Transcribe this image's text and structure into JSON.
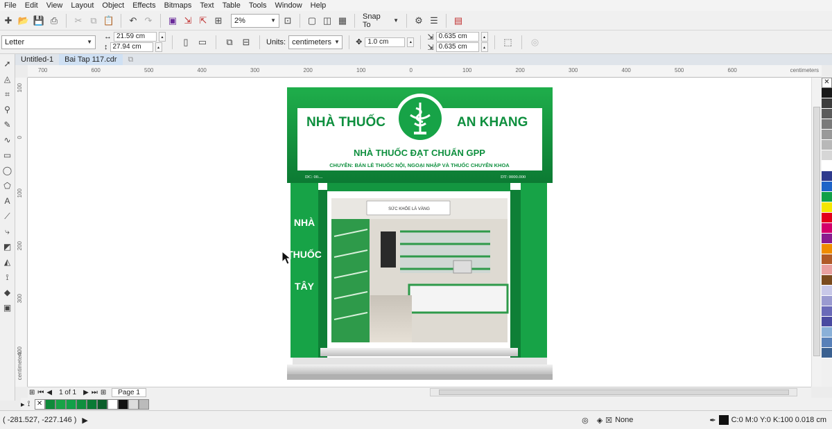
{
  "menu": [
    "File",
    "Edit",
    "View",
    "Layout",
    "Object",
    "Effects",
    "Bitmaps",
    "Text",
    "Table",
    "Tools",
    "Window",
    "Help"
  ],
  "toolbar": {
    "zoom": "2%",
    "snap_label": "Snap To"
  },
  "property_bar": {
    "paper": "Letter",
    "width": "21.59 cm",
    "height": "27.94 cm",
    "units_label": "Units:",
    "units": "centimeters",
    "nudge": "1.0 cm",
    "dup_x": "0.635 cm",
    "dup_y": "0.635 cm"
  },
  "doc_tabs": [
    "Untitled-1",
    "Bai Tap 117.cdr"
  ],
  "ruler": {
    "h_ticks": [
      "700",
      "600",
      "500",
      "400",
      "300",
      "200",
      "100",
      "0",
      "100",
      "200",
      "300",
      "400",
      "500",
      "600"
    ],
    "h_unit": "centimeters",
    "v_ticks": [
      "100",
      "0",
      "100",
      "200",
      "300",
      "400"
    ],
    "v_unit": "centimeters"
  },
  "store": {
    "brand_left": "NHÀ THUỐC",
    "brand_right": "AN KHANG",
    "subtitle": "NHÀ THUỐC ĐẠT CHUẨN GPP",
    "tagline": "CHUYÊN: BÁN LẺ THUỐC NỘI, NGOẠI NHẬP VÀ THUỐC CHUYÊN KHOA",
    "address": "DC: 00....",
    "phone": "DT: 0000.000",
    "side_sign": [
      "NHÀ",
      "THUỐC",
      "TÂY"
    ],
    "inner_sign": "SỨC KHỎE LÀ VÀNG"
  },
  "page_nav": {
    "count": "1 of 1",
    "page_tab": "Page 1"
  },
  "colors": {
    "palette": [
      "#1a1a1a",
      "#3d3d3d",
      "#5c5c5c",
      "#7a7a7a",
      "#999999",
      "#b8b8b8",
      "#d6d6d6",
      "#ffffff",
      "#2e3a8c",
      "#1e64c8",
      "#11a048",
      "#f4e600",
      "#e3001b",
      "#d4006b",
      "#8a1c8f",
      "#f08c00",
      "#b05a28",
      "#e9a0a0",
      "#7a4a1e",
      "#c8c8e8",
      "#9a9ad0",
      "#6a6ab8",
      "#4a4aa0",
      "#8ab0d8",
      "#5880b8",
      "#3a6090"
    ],
    "doc_palette": [
      "#0f8a3a",
      "#17a347",
      "#11a048",
      "#0e8f3e",
      "#0a7a34",
      "#0b5e2a",
      "#ffffff",
      "#111111",
      "#dddddd",
      "#bbbbbb"
    ]
  },
  "status": {
    "coords": "( -281.527, -227.146 )",
    "fill": "None",
    "outline": "C:0 M:0 Y:0 K:100  0.018 cm"
  }
}
